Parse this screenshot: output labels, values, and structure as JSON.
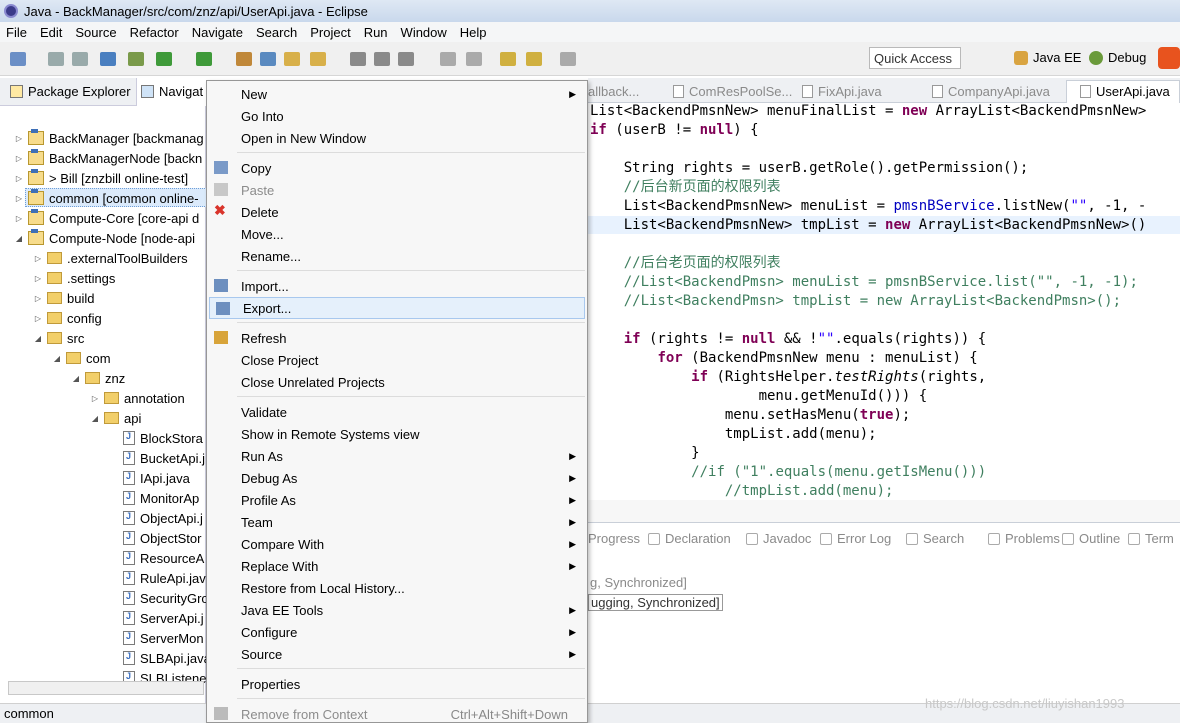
{
  "window": {
    "title": "Java - BackManager/src/com/znz/api/UserApi.java - Eclipse",
    "bg_title": "                                          "
  },
  "menubar": [
    "File",
    "Edit",
    "Source",
    "Refactor",
    "Navigate",
    "Search",
    "Project",
    "Run",
    "Window",
    "Help"
  ],
  "toolbar": {
    "quick_access": "Quick Access",
    "perspectives": [
      "Java EE",
      "Debug"
    ]
  },
  "left_tabs": [
    "Package Explorer",
    "Navigat"
  ],
  "tree": [
    {
      "label": "BackManager  [backmanag",
      "type": "project",
      "tw": "▷"
    },
    {
      "label": "BackManagerNode  [backn",
      "type": "project",
      "tw": "▷"
    },
    {
      "label": "> Bill  [znzbill online-test]",
      "type": "project",
      "tw": "▷"
    },
    {
      "label": "common  [common online-",
      "type": "project",
      "tw": "▷"
    },
    {
      "label": "Compute-Core  [core-api d",
      "type": "project",
      "tw": "▷"
    },
    {
      "label": "Compute-Node  [node-api",
      "type": "project",
      "tw": "◢"
    },
    {
      "label": ".externalToolBuilders",
      "type": "folder",
      "tw": "▷"
    },
    {
      "label": ".settings",
      "type": "folder",
      "tw": "▷"
    },
    {
      "label": "build",
      "type": "folder",
      "tw": "▷"
    },
    {
      "label": "config",
      "type": "folder",
      "tw": "▷"
    },
    {
      "label": "src",
      "type": "folder",
      "tw": "◢"
    },
    {
      "label": "com",
      "type": "folder",
      "tw": "◢"
    },
    {
      "label": "znz",
      "type": "folder",
      "tw": "◢"
    },
    {
      "label": "annotation",
      "type": "folder",
      "tw": "▷"
    },
    {
      "label": "api",
      "type": "folder",
      "tw": "◢"
    },
    {
      "label": "BlockStora",
      "type": "java",
      "tw": ""
    },
    {
      "label": "BucketApi.j",
      "type": "java",
      "tw": ""
    },
    {
      "label": "IApi.java",
      "type": "java",
      "tw": ""
    },
    {
      "label": "MonitorAp",
      "type": "java",
      "tw": ""
    },
    {
      "label": "ObjectApi.j",
      "type": "java",
      "tw": ""
    },
    {
      "label": "ObjectStor",
      "type": "java",
      "tw": ""
    },
    {
      "label": "ResourceA",
      "type": "java",
      "tw": ""
    },
    {
      "label": "RuleApi.jav",
      "type": "java",
      "tw": ""
    },
    {
      "label": "SecurityGro",
      "type": "java",
      "tw": ""
    },
    {
      "label": "ServerApi.j",
      "type": "java",
      "tw": ""
    },
    {
      "label": "ServerMon",
      "type": "java",
      "tw": ""
    },
    {
      "label": "SLBApi.java",
      "type": "java",
      "tw": ""
    },
    {
      "label": "SLBListene",
      "type": "java",
      "tw": ""
    }
  ],
  "editor_tabs": [
    "allback...",
    "ComResPoolSe...",
    "FixApi.java",
    "CompanyApi.java",
    "UserApi.java"
  ],
  "code": [
    "List<BackendPmsnNew> menuFinalList = new ArrayList<BackendPmsnNew>",
    "if (userB != null) {",
    "",
    "    String rights = userB.getRole().getPermission();",
    "    //后台新页面的权限列表",
    "    List<BackendPmsnNew> menuList = pmsnBService.listNew(\"\", -1, -",
    "    List<BackendPmsnNew> tmpList = new ArrayList<BackendPmsnNew>()",
    "",
    "    //后台老页面的权限列表",
    "    //List<BackendPmsn> menuList = pmsnBService.list(\"\", -1, -1);",
    "    //List<BackendPmsn> tmpList = new ArrayList<BackendPmsn>();",
    "",
    "    if (rights != null && !\"\".equals(rights)) {",
    "        for (BackendPmsnNew menu : menuList) {",
    "            if (RightsHelper.testRights(rights,",
    "                    menu.getMenuId())) {",
    "                menu.setHasMenu(true);",
    "                tmpList.add(menu);",
    "            }",
    "            //if (\"1\".equals(menu.getIsMenu()))",
    "                //tmpList.add(menu);"
  ],
  "bottom_tabs": [
    "Progress",
    "Declaration",
    "Javadoc",
    "Error Log",
    "Search",
    "Problems",
    "Outline",
    "Term"
  ],
  "console": [
    "g, Synchronized]",
    "ugging, Synchronized]"
  ],
  "context_menu": [
    {
      "label": "New",
      "sub": true
    },
    {
      "label": "Go Into"
    },
    {
      "label": "Open in New Window"
    },
    {
      "sep": true
    },
    {
      "label": "Copy",
      "icon": "copy"
    },
    {
      "label": "Paste",
      "icon": "paste",
      "disabled": true
    },
    {
      "label": "Delete",
      "icon": "delete"
    },
    {
      "label": "Move..."
    },
    {
      "label": "Rename..."
    },
    {
      "sep": true
    },
    {
      "label": "Import...",
      "icon": "import"
    },
    {
      "label": "Export...",
      "icon": "export",
      "hover": true
    },
    {
      "sep": true
    },
    {
      "label": "Refresh",
      "icon": "refresh"
    },
    {
      "label": "Close Project"
    },
    {
      "label": "Close Unrelated Projects"
    },
    {
      "sep": true
    },
    {
      "label": "Validate"
    },
    {
      "label": "Show in Remote Systems view"
    },
    {
      "label": "Run As",
      "sub": true
    },
    {
      "label": "Debug As",
      "sub": true
    },
    {
      "label": "Profile As",
      "sub": true
    },
    {
      "label": "Team",
      "sub": true
    },
    {
      "label": "Compare With",
      "sub": true
    },
    {
      "label": "Replace With",
      "sub": true
    },
    {
      "label": "Restore from Local History..."
    },
    {
      "label": "Java EE Tools",
      "sub": true
    },
    {
      "label": "Configure",
      "sub": true
    },
    {
      "label": "Source",
      "sub": true
    },
    {
      "sep": true
    },
    {
      "label": "Properties"
    },
    {
      "sep": true
    },
    {
      "label": "Remove from Context",
      "icon": "remove",
      "disabled": true,
      "accel": "Ctrl+Alt+Shift+Down"
    }
  ],
  "status": {
    "text": "common"
  },
  "watermark": "https://blog.csdn.net/liuyishan1993"
}
